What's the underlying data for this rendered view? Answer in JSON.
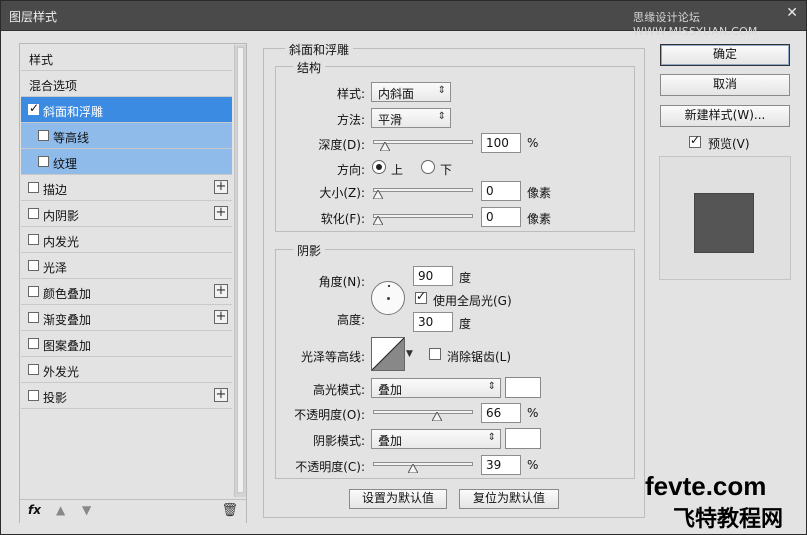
{
  "window": {
    "title": "图层样式",
    "watermark_top": "思缘设计论坛 WWW.MISSYUAN.COM",
    "close": "✕"
  },
  "left": {
    "items": [
      {
        "label": "样式",
        "type": "plain"
      },
      {
        "label": "混合选项",
        "type": "plain"
      },
      {
        "label": "斜面和浮雕",
        "type": "selected",
        "checked": true
      },
      {
        "label": "等高线",
        "type": "sub",
        "checked": false
      },
      {
        "label": "纹理",
        "type": "sub",
        "checked": false
      },
      {
        "label": "描边",
        "type": "check",
        "plus": true
      },
      {
        "label": "内阴影",
        "type": "check",
        "plus": true
      },
      {
        "label": "内发光",
        "type": "check"
      },
      {
        "label": "光泽",
        "type": "check"
      },
      {
        "label": "颜色叠加",
        "type": "check",
        "plus": true
      },
      {
        "label": "渐变叠加",
        "type": "check",
        "plus": true
      },
      {
        "label": "图案叠加",
        "type": "check"
      },
      {
        "label": "外发光",
        "type": "check"
      },
      {
        "label": "投影",
        "type": "check",
        "plus": true
      }
    ],
    "fx": "fx",
    "plus_glyph": "+"
  },
  "bevel": {
    "section_title": "斜面和浮雕",
    "structure_title": "结构",
    "style_label": "样式:",
    "style_value": "内斜面",
    "method_label": "方法:",
    "method_value": "平滑",
    "depth_label": "深度(D):",
    "depth_value": "100",
    "depth_level": 0.08,
    "percent": "%",
    "direction_label": "方向:",
    "dir_up": "上",
    "dir_down": "下",
    "size_label": "大小(Z):",
    "size_value": "0",
    "size_level": 0.0,
    "pixel": "像素",
    "soften_label": "软化(F):",
    "soften_value": "0",
    "soften_level": 0.0
  },
  "shading": {
    "title": "阴影",
    "angle_label": "角度(N):",
    "angle_value": "90",
    "degree": "度",
    "global_light_label": "使用全局光(G)",
    "altitude_label": "高度:",
    "altitude_value": "30",
    "gloss_label": "光泽等高线:",
    "anti_alias_label": "消除锯齿(L)",
    "highlight_mode_label": "高光模式:",
    "highlight_mode_value": "叠加",
    "highlight_opacity_label": "不透明度(O):",
    "highlight_opacity_value": "66",
    "highlight_opacity_level": 0.66,
    "shadow_mode_label": "阴影模式:",
    "shadow_mode_value": "叠加",
    "shadow_opacity_label": "不透明度(C):",
    "shadow_opacity_value": "39",
    "shadow_opacity_level": 0.39,
    "percent": "%"
  },
  "buttons": {
    "make_default": "设置为默认值",
    "reset_default": "复位为默认值",
    "ok": "确定",
    "cancel": "取消",
    "new_style": "新建样式(W)...",
    "preview": "预览(V)"
  },
  "watermark": {
    "line1": "fevte.com",
    "line2": "飞特教程网"
  }
}
